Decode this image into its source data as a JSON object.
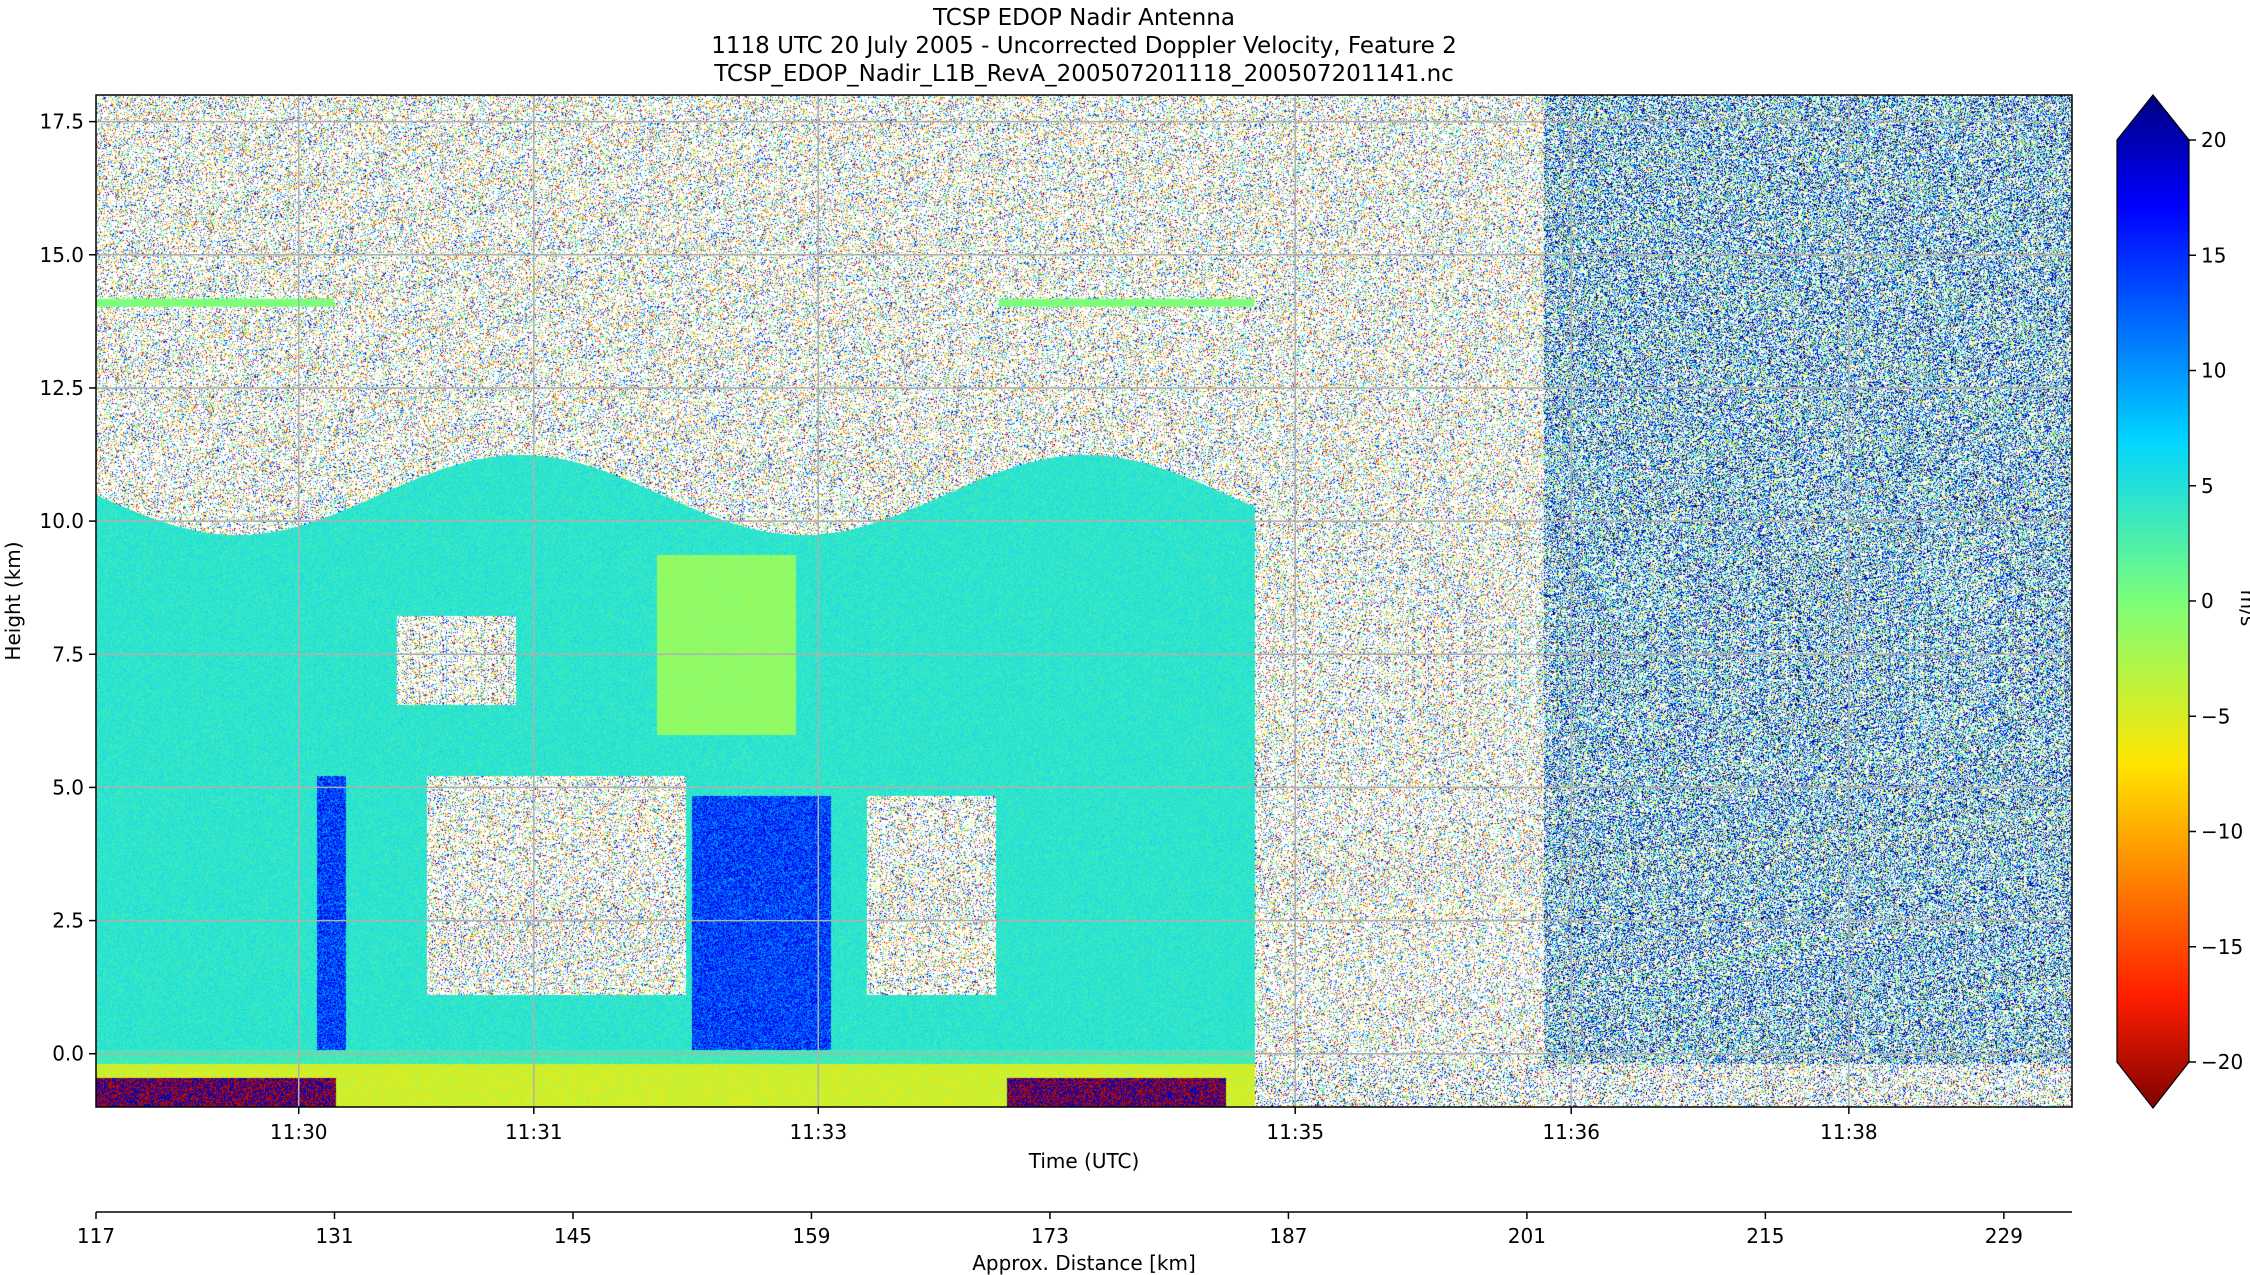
{
  "chart_data": {
    "type": "heatmap",
    "title_lines": [
      "TCSP EDOP Nadir Antenna",
      "1118 UTC 20 July 2005 - Uncorrected Doppler Velocity, Feature 2",
      "TCSP_EDOP_Nadir_L1B_RevA_200507201118_200507201141.nc"
    ],
    "xlabel": "Time (UTC)",
    "ylabel": "Height (km)",
    "x_ticks": [
      "11:30",
      "11:31",
      "11:33",
      "11:35",
      "11:36",
      "11:38"
    ],
    "y_ticks": [
      "17.5",
      "15.0",
      "12.5",
      "10.0",
      "7.5",
      "5.0",
      "2.5",
      "0.0"
    ],
    "y_tick_values": [
      17.5,
      15.0,
      12.5,
      10.0,
      7.5,
      5.0,
      2.5,
      0.0
    ],
    "ylim": [
      -1.0,
      18.0
    ],
    "x2label": "Approx. Distance [km]",
    "x2_ticks": [
      "117",
      "131",
      "145",
      "159",
      "173",
      "187",
      "201",
      "215",
      "229"
    ],
    "x2_tick_values": [
      117,
      131,
      145,
      159,
      173,
      187,
      201,
      215,
      229
    ],
    "x2lim": [
      117,
      233
    ],
    "colorbar": {
      "label": "m/s",
      "range": [
        -20,
        20
      ],
      "ticks": [
        "20",
        "15",
        "10",
        "5",
        "0",
        "−10",
        "−15",
        "−20",
        "−5"
      ],
      "tick_values": [
        20,
        15,
        10,
        5,
        0,
        -10,
        -15,
        -20,
        -5
      ],
      "colormap": "jet_r"
    },
    "grid": true,
    "features": {
      "echo_top_km": 10.5,
      "echo_end_distance_km": 185,
      "surface_height_km": 0.0,
      "flight_level_km": 14.1
    }
  }
}
